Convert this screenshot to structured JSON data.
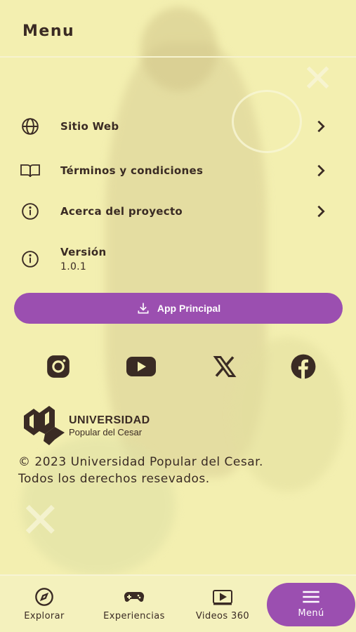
{
  "header": {
    "title": "Menu"
  },
  "menu": {
    "items": [
      {
        "label": "Sitio Web",
        "icon": "globe-icon"
      },
      {
        "label": "Términos y condiciones",
        "icon": "book-icon"
      },
      {
        "label": "Acerca del proyecto",
        "icon": "info-icon"
      }
    ],
    "version": {
      "label": "Versión",
      "value": "1.0.1",
      "icon": "info-icon"
    }
  },
  "primary_button": {
    "label": "App Principal",
    "icon": "download-icon",
    "color": "#9b4fb0"
  },
  "social": [
    {
      "icon": "instagram-icon"
    },
    {
      "icon": "youtube-icon"
    },
    {
      "icon": "x-icon"
    },
    {
      "icon": "facebook-icon"
    }
  ],
  "logo": {
    "line1": "UNIVERSIDAD",
    "line2": "Popular del Cesar"
  },
  "copyright": {
    "line1": "© 2023 Universidad Popular del Cesar.",
    "line2": "Todos los derechos resevados."
  },
  "tabs": [
    {
      "label": "Explorar",
      "icon": "compass-icon"
    },
    {
      "label": "Experiencias",
      "icon": "gamepad-icon"
    },
    {
      "label": "Videos 360",
      "icon": "play-icon"
    },
    {
      "label": "Menú",
      "icon": "hamburger-icon",
      "active": true
    }
  ],
  "colors": {
    "accent": "#9b4fb0",
    "text": "#3a2b24",
    "background": "#f3efb0"
  }
}
